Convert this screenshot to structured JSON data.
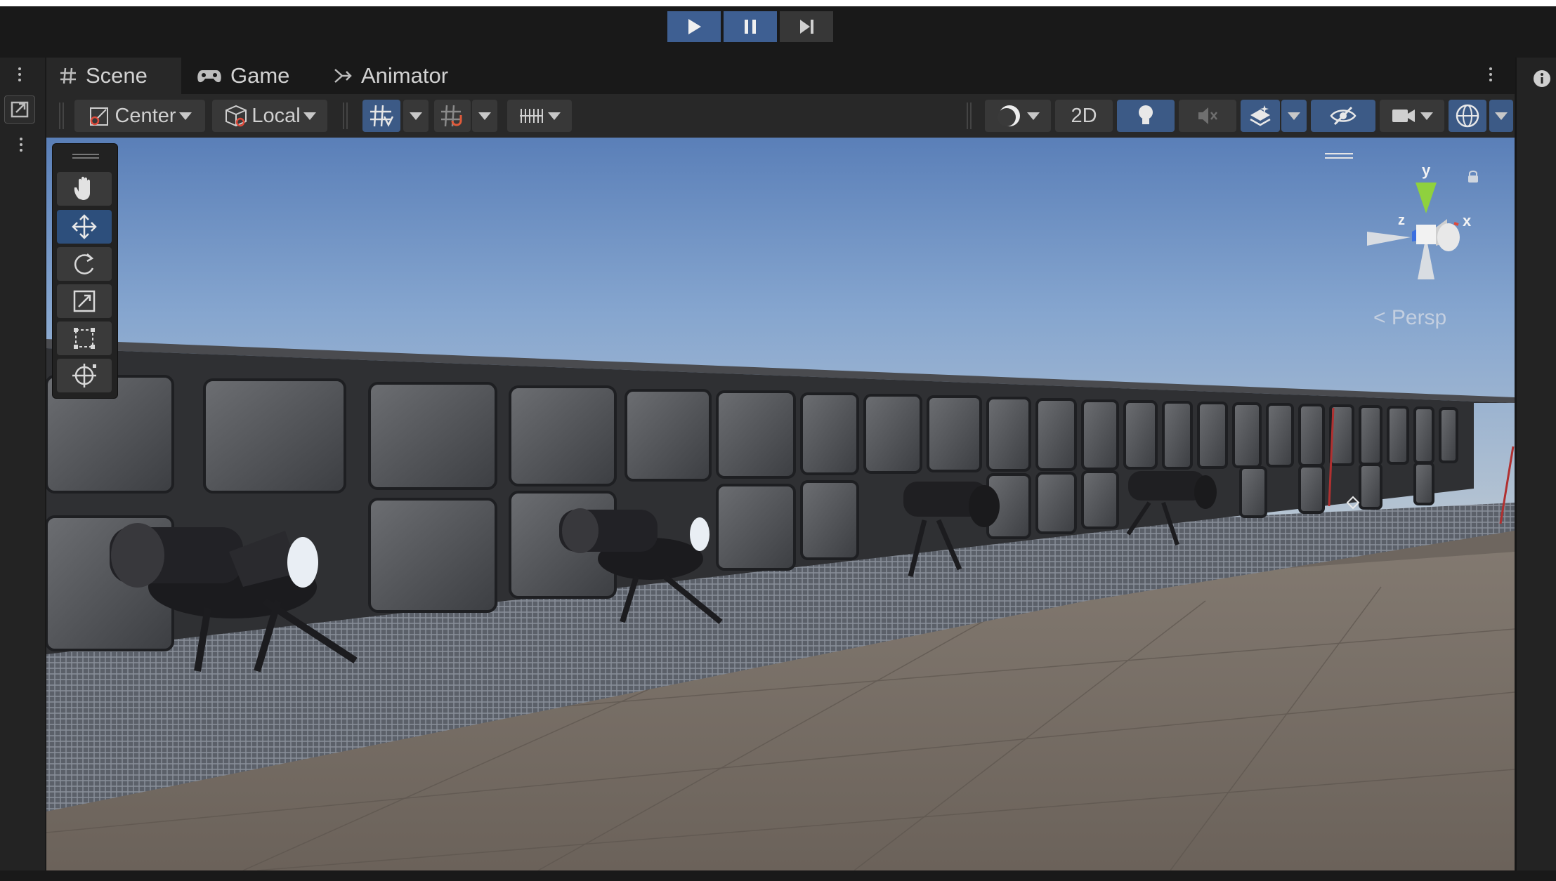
{
  "play_controls": {
    "play": "play-icon",
    "pause": "pause-icon",
    "step": "step-icon"
  },
  "tabs": [
    {
      "label": "Scene",
      "icon": "grid-icon",
      "active": true
    },
    {
      "label": "Game",
      "icon": "gamepad-icon",
      "active": false
    },
    {
      "label": "Animator",
      "icon": "animator-icon",
      "active": false
    }
  ],
  "toolbar": {
    "pivot_label": "Center",
    "space_label": "Local",
    "mode_2d_label": "2D"
  },
  "tools": [
    "hand-tool",
    "move-tool",
    "rotate-tool",
    "scale-tool",
    "rect-tool",
    "transform-tool"
  ],
  "gizmo": {
    "y_label": "y",
    "x_label": "x",
    "z_label": "z",
    "projection_label": "Persp"
  },
  "colors": {
    "accent": "#3e5f92",
    "axis_y": "#8fd13e",
    "axis_x": "#e04a3a",
    "axis_z": "#3b6fe0"
  }
}
